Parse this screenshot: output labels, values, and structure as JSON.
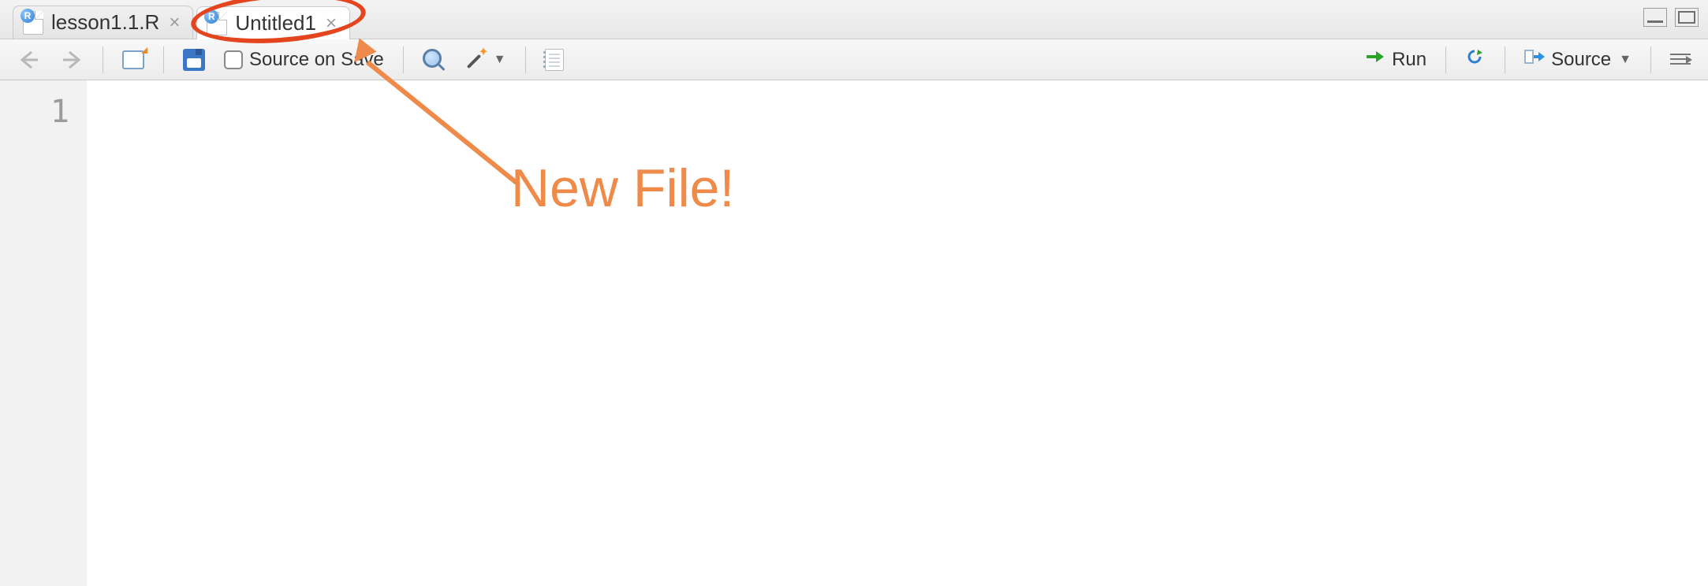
{
  "tabs": [
    {
      "label": "lesson1.1.R",
      "active": false
    },
    {
      "label": "Untitled1",
      "active": true
    }
  ],
  "toolbar": {
    "source_on_save_label": "Source on Save",
    "run_label": "Run",
    "source_label": "Source"
  },
  "editor": {
    "line_numbers": [
      "1"
    ],
    "content": ""
  },
  "annotation": {
    "text": "New File!"
  }
}
